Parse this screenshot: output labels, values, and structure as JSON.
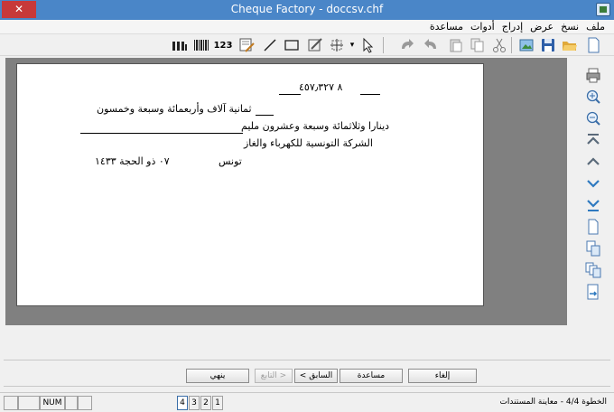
{
  "window": {
    "title": "Cheque Factory - doccsv.chf",
    "close_glyph": "✕"
  },
  "menu": [
    "ملف",
    "نسخ",
    "عرض",
    "إدراج",
    "أدوات",
    "مساعدة"
  ],
  "toolbar": {
    "number_tool_label": "123",
    "dropdown_glyph": "▾"
  },
  "cheque": {
    "amount": "٨ ٤٥٧٫٣٢٧",
    "words_line1": "ثمانية آلاف وأربعمائة وسبعة وخمسون",
    "words_line2": "دينارا وثلاثمائة وسبعة وعشرون مليم",
    "payee": "الشركة التونسية للكهرباء والغاز",
    "place": "تونس",
    "date": "٠٧ ذو الحجة ١٤٣٣"
  },
  "buttons": {
    "cancel": "إلغاء",
    "help": "مساعدة",
    "previous": "< السابق",
    "next": "التابع >",
    "finish": "ينهي"
  },
  "status": {
    "text": "الخطوة 4/4 - معاينة المستندات",
    "num": "NUM",
    "pages": [
      "1",
      "2",
      "3",
      "4"
    ],
    "current_page": "4"
  }
}
